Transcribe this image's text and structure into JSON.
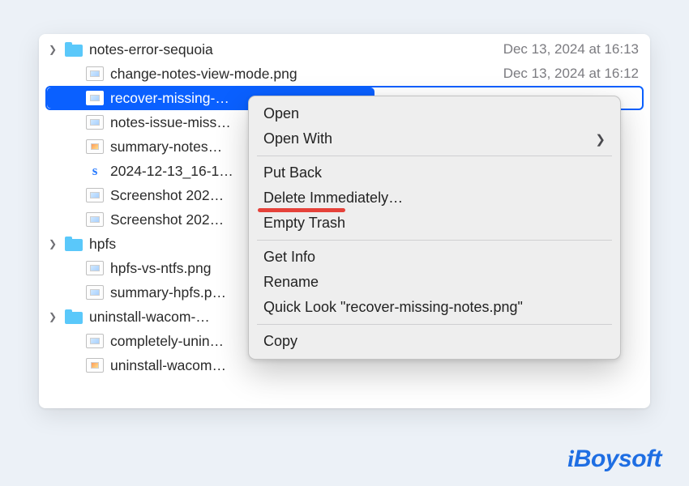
{
  "files": [
    {
      "name": "notes-error-sequoia",
      "date": "Dec 13, 2024 at 16:13",
      "type": "folder",
      "disclosure": true,
      "indent": 0
    },
    {
      "name": "change-notes-view-mode.png",
      "date": "Dec 13, 2024 at 16:12",
      "type": "image",
      "indent": 1
    },
    {
      "name": "recover-missing-…",
      "type": "image",
      "selected": true,
      "indent": 1,
      "full_name_hint": "recover-missing-notes.png"
    },
    {
      "name": "notes-issue-miss…",
      "type": "image",
      "indent": 1
    },
    {
      "name": "summary-notes…",
      "type": "image-mini",
      "indent": 1
    },
    {
      "name": "2024-12-13_16-1…",
      "type": "s",
      "indent": 1
    },
    {
      "name": "Screenshot 202…",
      "type": "image",
      "indent": 1
    },
    {
      "name": "Screenshot 202…",
      "type": "image",
      "indent": 1
    },
    {
      "name": "hpfs",
      "type": "folder",
      "disclosure": true,
      "indent": 0
    },
    {
      "name": "hpfs-vs-ntfs.png",
      "type": "image",
      "indent": 1
    },
    {
      "name": "summary-hpfs.p…",
      "type": "image",
      "indent": 1
    },
    {
      "name": "uninstall-wacom-…",
      "type": "folder",
      "disclosure": true,
      "indent": 0
    },
    {
      "name": "completely-unin…",
      "type": "image",
      "indent": 1
    },
    {
      "name": "uninstall-wacom…",
      "type": "image-mini",
      "indent": 1
    }
  ],
  "context_menu": {
    "open": "Open",
    "open_with": "Open With",
    "put_back": "Put Back",
    "delete_immediately": "Delete Immediately…",
    "empty_trash": "Empty Trash",
    "get_info": "Get Info",
    "rename": "Rename",
    "quick_look": "Quick Look \"recover-missing-notes.png\"",
    "copy": "Copy",
    "highlighted": "put_back"
  },
  "brand": "iBoysoft"
}
